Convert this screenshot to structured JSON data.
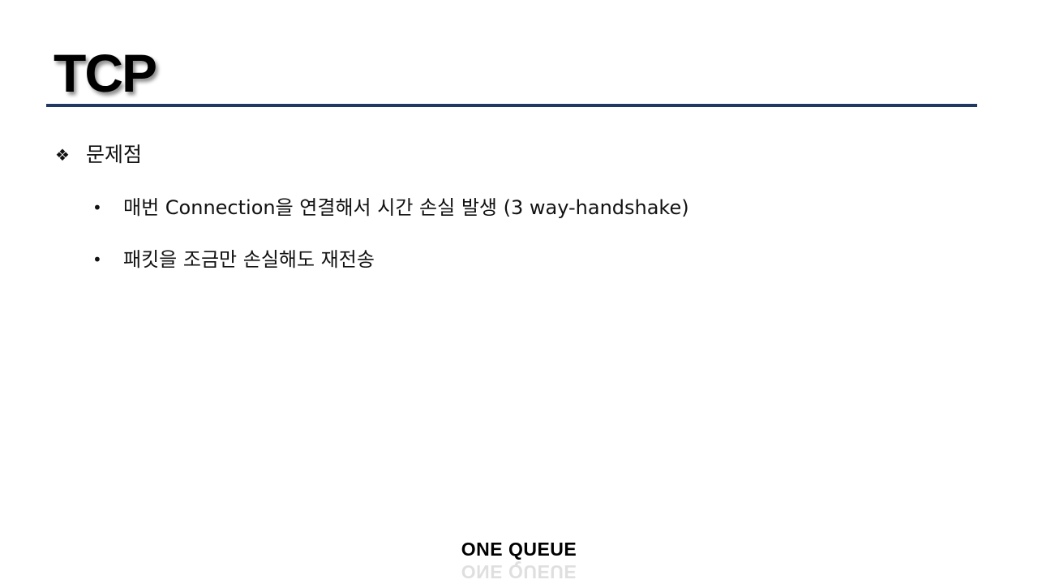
{
  "slide": {
    "title": "TCP",
    "section": {
      "marker": "❖",
      "heading": "문제점"
    },
    "bullets": [
      {
        "marker": "•",
        "text": "매번 Connection을 연결해서 시간 손실 발생 (3 way-handshake)"
      },
      {
        "marker": "•",
        "text": "패킷을 조금만 손실해도 재전송"
      }
    ],
    "footer": "ONE QUEUE"
  },
  "colors": {
    "rule": "#1f3864",
    "text": "#111111"
  }
}
